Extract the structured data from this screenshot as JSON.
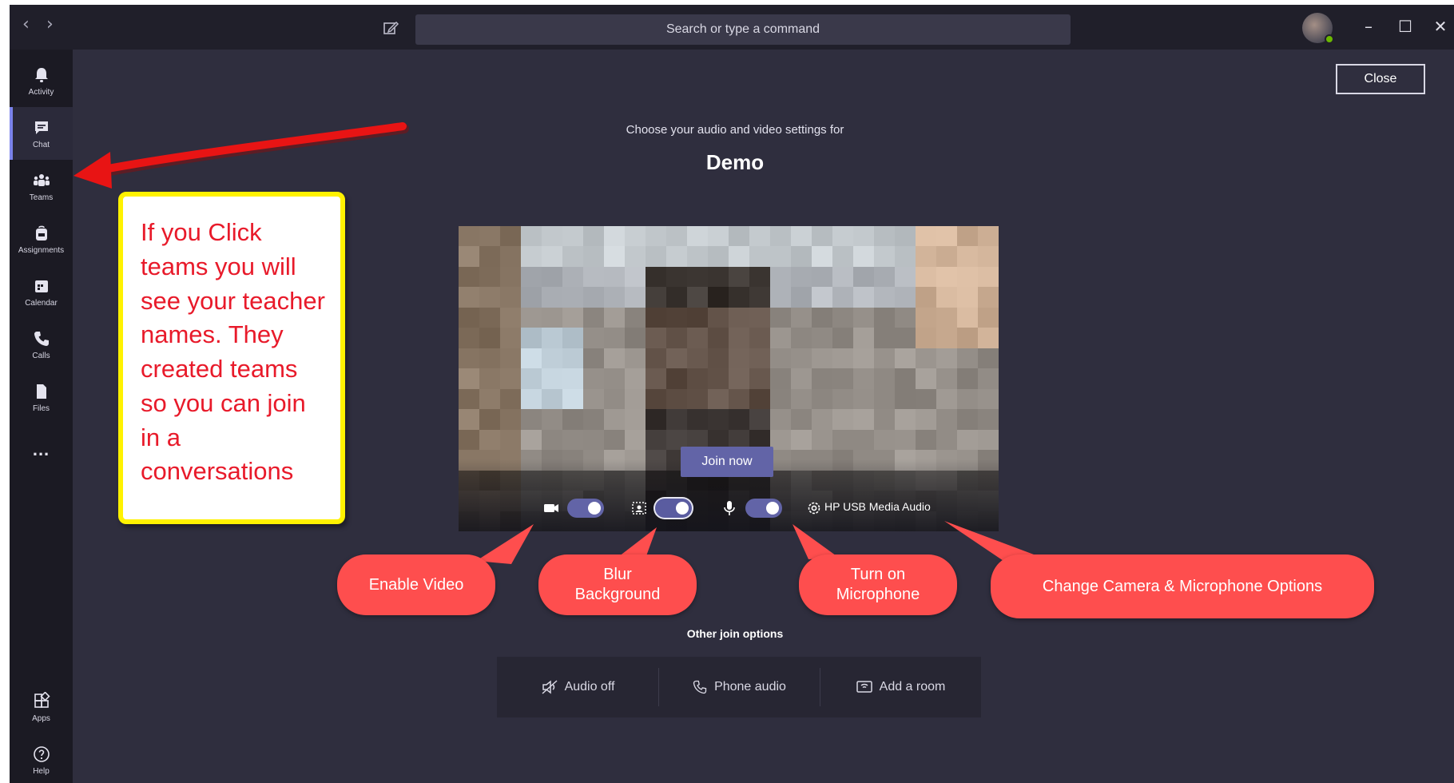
{
  "titlebar": {
    "back_label": "‹",
    "forward_label": "›",
    "compose_icon": "compose-icon",
    "search_placeholder": "Search or type a command",
    "minimize_label": "–",
    "maximize_label": "☐",
    "close_label": "✕"
  },
  "rail": {
    "items": [
      {
        "label": "Activity",
        "icon": "bell-icon"
      },
      {
        "label": "Chat",
        "icon": "chat-icon"
      },
      {
        "label": "Teams",
        "icon": "teams-icon"
      },
      {
        "label": "Assignments",
        "icon": "backpack-icon"
      },
      {
        "label": "Calendar",
        "icon": "calendar-icon"
      },
      {
        "label": "Calls",
        "icon": "phone-icon"
      },
      {
        "label": "Files",
        "icon": "file-icon"
      }
    ],
    "more_label": "...",
    "bottom": [
      {
        "label": "Apps",
        "icon": "apps-icon"
      },
      {
        "label": "Help",
        "icon": "help-icon"
      }
    ],
    "active": "Chat"
  },
  "prejoin": {
    "close_label": "Close",
    "prompt": "Choose your audio and video settings for",
    "meeting_name": "Demo",
    "join_label": "Join now",
    "video_on": true,
    "blur_on": true,
    "mic_on": true,
    "device_label": "HP USB Media Audio"
  },
  "annotations": {
    "note": "If you Click teams you will see your teacher names. They created teams so you can join in a conversations",
    "callouts": {
      "video": "Enable Video",
      "blur_line1": "Blur",
      "blur_line2": "Background",
      "mic_line1": "Turn on",
      "mic_line2": "Microphone",
      "device": "Change Camera & Microphone Options"
    },
    "colors": {
      "callout": "#fe4e4e",
      "note_border": "#fff200",
      "note_text": "#e81a2a",
      "arrow": "#e81414"
    }
  },
  "other_join": {
    "title": "Other join options",
    "options": [
      {
        "label": "Audio off",
        "icon": "speaker-off-icon"
      },
      {
        "label": "Phone audio",
        "icon": "phone-icon"
      },
      {
        "label": "Add a room",
        "icon": "room-icon"
      }
    ]
  },
  "colors": {
    "accent": "#6264a7",
    "app_bg": "#2f2e3e",
    "rail_bg": "#1b1a23"
  }
}
